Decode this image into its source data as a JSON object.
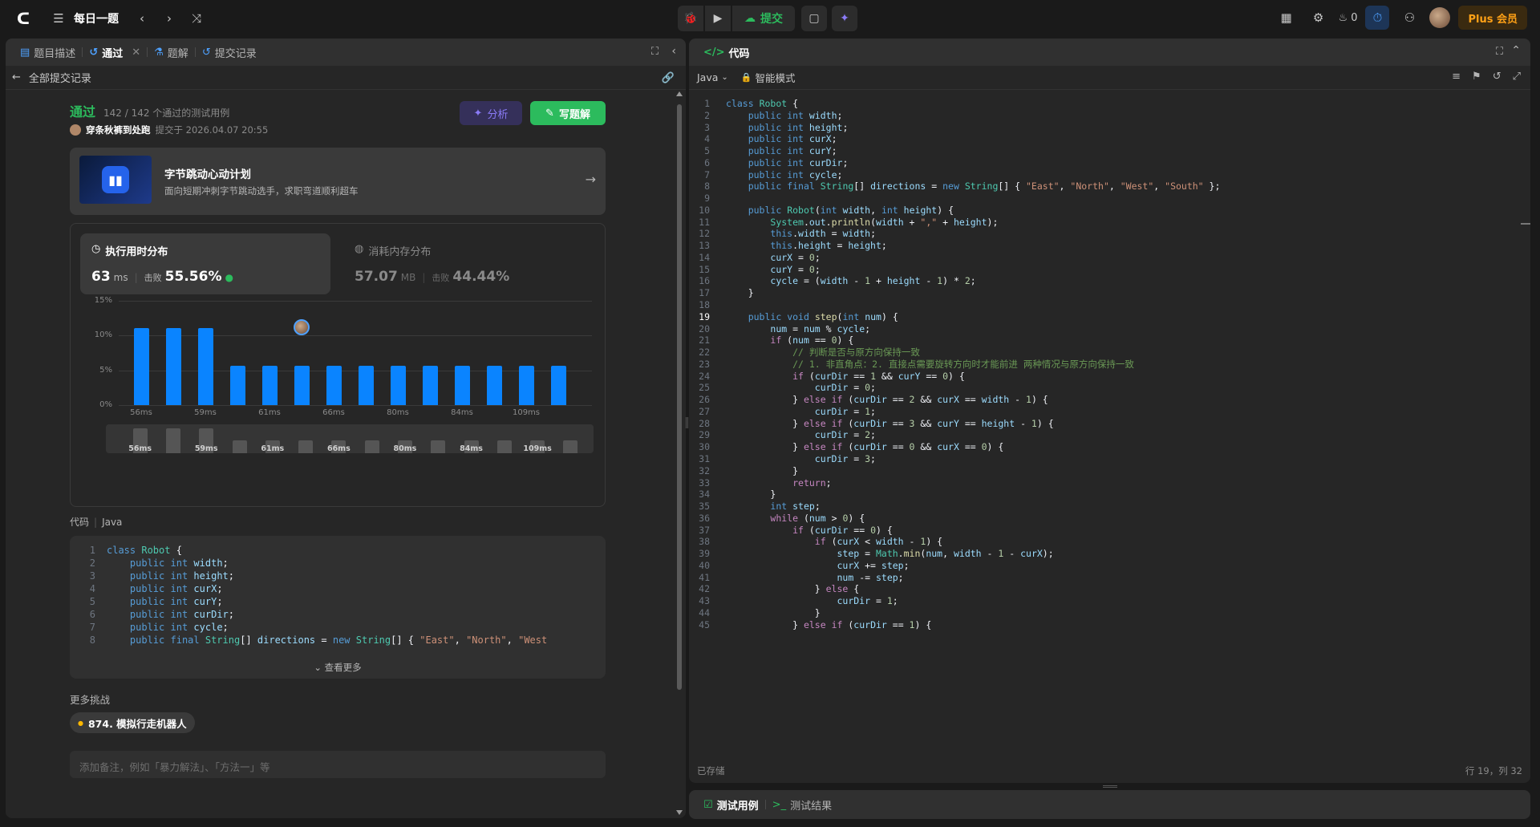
{
  "topbar": {
    "title": "每日一题",
    "submit_label": "提交",
    "streak_count": "0",
    "plus_label": "Plus 会员"
  },
  "left_tabs": [
    {
      "label": "题目描述"
    },
    {
      "label": "通过"
    },
    {
      "label": "题解"
    },
    {
      "label": "提交记录"
    }
  ],
  "back_label": "全部提交记录",
  "result": {
    "status": "通过",
    "cases": "142 / 142 个通过的测试用例",
    "user": "穿条秋裤到处跑",
    "submitted_at": "提交于 2026.04.07 20:55",
    "analyze_label": "分析",
    "write_solution_label": "写题解"
  },
  "promo": {
    "title": "字节跳动心动计划",
    "subtitle": "面向短期冲刺字节跳动选手，求职弯道顺利超车"
  },
  "stats": {
    "time_title": "执行用时分布",
    "time_value": "63",
    "time_unit": "ms",
    "beat_label": "击败",
    "time_beat": "55.56%",
    "mem_title": "消耗内存分布",
    "mem_value": "57.07",
    "mem_unit": "MB",
    "mem_beat": "44.44%"
  },
  "chart_data": {
    "type": "bar",
    "y_ticks": [
      "15%",
      "10%",
      "5%",
      "0%"
    ],
    "ylim": [
      0,
      15
    ],
    "values": [
      11.1,
      11.1,
      11.1,
      5.6,
      5.6,
      5.6,
      5.6,
      5.6,
      5.6,
      5.6,
      5.6,
      5.6,
      5.6,
      5.6
    ],
    "x_labels": [
      "56ms",
      "59ms",
      "61ms",
      "66ms",
      "80ms",
      "84ms",
      "109ms"
    ],
    "mini_labels": [
      "56ms",
      "59ms",
      "61ms",
      "66ms",
      "80ms",
      "84ms",
      "109ms"
    ],
    "user_bar_index": 5,
    "bar_color": "#0a84ff"
  },
  "code_section": {
    "title": "代码",
    "lang": "Java",
    "more_label": "查看更多"
  },
  "snippet": [
    "class Robot {",
    "    public int width;",
    "    public int height;",
    "    public int curX;",
    "    public int curY;",
    "    public int curDir;",
    "    public int cycle;",
    "    public final String[] directions = new String[] { \"East\", \"North\", \"West"
  ],
  "more_challenges": {
    "title": "更多挑战",
    "item": "874. 模拟行走机器人"
  },
  "note_placeholder": "添加备注，例如「暴力解法」、「方法一」等",
  "editor": {
    "title": "代码",
    "lang": "Java",
    "mode": "智能模式",
    "saved": "已存储",
    "cursor": "行 19，列 32"
  },
  "code": [
    "class Robot {",
    "    public int width;",
    "    public int height;",
    "    public int curX;",
    "    public int curY;",
    "    public int curDir;",
    "    public int cycle;",
    "    public final String[] directions = new String[] { \"East\", \"North\", \"West\", \"South\" };",
    "",
    "    public Robot(int width, int height) {",
    "        System.out.println(width + \",\" + height);",
    "        this.width = width;",
    "        this.height = height;",
    "        curX = 0;",
    "        curY = 0;",
    "        cycle = (width - 1 + height - 1) * 2;",
    "    }",
    "",
    "    public void step(int num) {",
    "        num = num % cycle;",
    "        if (num == 0) {",
    "            // 判断是否与原方向保持一致",
    "            // 1. 非直角点：2. 直接点需要旋转方向时才能前进 两种情况与原方向保持一致",
    "            if (curDir == 1 && curY == 0) {",
    "                curDir = 0;",
    "            } else if (curDir == 2 && curX == width - 1) {",
    "                curDir = 1;",
    "            } else if (curDir == 3 && curY == height - 1) {",
    "                curDir = 2;",
    "            } else if (curDir == 0 && curX == 0) {",
    "                curDir = 3;",
    "            }",
    "            return;",
    "        }",
    "        int step;",
    "        while (num > 0) {",
    "            if (curDir == 0) {",
    "                if (curX < width - 1) {",
    "                    step = Math.min(num, width - 1 - curX);",
    "                    curX += step;",
    "                    num -= step;",
    "                } else {",
    "                    curDir = 1;",
    "                }",
    "            } else if (curDir == 1) {"
  ],
  "bottom_tabs": [
    {
      "label": "测试用例"
    },
    {
      "label": "测试结果"
    }
  ]
}
